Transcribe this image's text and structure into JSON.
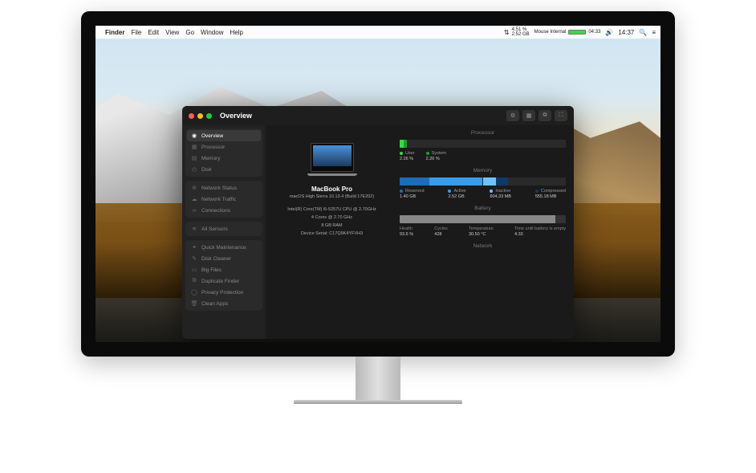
{
  "menubar": {
    "app": "Finder",
    "items": [
      "File",
      "Edit",
      "View",
      "Go",
      "Window",
      "Help"
    ],
    "cpu_pct": "4.51 %",
    "mem_used": "2.52 GB",
    "mouse_label": "Mouse Internal",
    "mouse_time": "04:33",
    "clock": "14:37"
  },
  "window": {
    "title": "Overview",
    "sidebar": {
      "group1": [
        {
          "icon": "gauge",
          "label": "Overview",
          "active": true
        },
        {
          "icon": "cpu",
          "label": "Processor"
        },
        {
          "icon": "mem",
          "label": "Memory"
        },
        {
          "icon": "disk",
          "label": "Disk"
        }
      ],
      "group2": [
        {
          "icon": "net",
          "label": "Network Status"
        },
        {
          "icon": "cloud",
          "label": "Network Traffic"
        },
        {
          "icon": "link",
          "label": "Connections"
        }
      ],
      "group3": [
        {
          "icon": "sensor",
          "label": "All Sensors"
        }
      ],
      "group4": [
        {
          "icon": "wrench",
          "label": "Quick Maintenance"
        },
        {
          "icon": "brush",
          "label": "Disk Cleaner"
        },
        {
          "icon": "file",
          "label": "Big Files"
        },
        {
          "icon": "dup",
          "label": "Duplicate Finder"
        },
        {
          "icon": "shield",
          "label": "Privacy Protection"
        },
        {
          "icon": "trash",
          "label": "Clean Apps"
        }
      ]
    }
  },
  "info": {
    "model": "MacBook Pro",
    "os": "macOS High Sierra 10.13.4 (Build 17E202)",
    "cpu": "Intel(R) Core(TM) i5-5257U CPU @ 2.70GHz",
    "cores": "4 Cores @ 2.70 GHz",
    "ram": "8 GB RAM",
    "serial": "Device Serial: C17Q9K4YFVH3"
  },
  "processor": {
    "title": "Processor",
    "user": {
      "label": "User",
      "value": "2.26 %",
      "color": "#3dd64a",
      "pct": 2.26
    },
    "system": {
      "label": "System",
      "value": "2.26 %",
      "color": "#1f9e2e",
      "pct": 2.26
    }
  },
  "memory": {
    "title": "Memory",
    "items": [
      {
        "label": "Reserved",
        "value": "1.40 GB",
        "color": "#1e6bb8",
        "pct": 18
      },
      {
        "label": "Active",
        "value": "2.52 GB",
        "color": "#3a9be8",
        "pct": 32
      },
      {
        "label": "Inactive",
        "value": "604.33 MB",
        "color": "#6fc2ff",
        "pct": 8
      },
      {
        "label": "Compressed",
        "value": "555.18 MB",
        "color": "#0d3a66",
        "pct": 7
      }
    ]
  },
  "battery": {
    "title": "Battery",
    "items": [
      {
        "label": "Health",
        "value": "93.6 %"
      },
      {
        "label": "Cycles",
        "value": "428"
      },
      {
        "label": "Temperature",
        "value": "30.50 °C"
      },
      {
        "label": "Time until battery is empty",
        "value": "4:33"
      }
    ]
  },
  "network": {
    "title": "Network"
  },
  "icons": {
    "gauge": "◉",
    "cpu": "▦",
    "mem": "▤",
    "disk": "◴",
    "net": "⊕",
    "cloud": "☁",
    "link": "∞",
    "sensor": "≋",
    "wrench": "✦",
    "brush": "✎",
    "file": "▭",
    "dup": "⧉",
    "shield": "◯",
    "trash": "🗑"
  }
}
